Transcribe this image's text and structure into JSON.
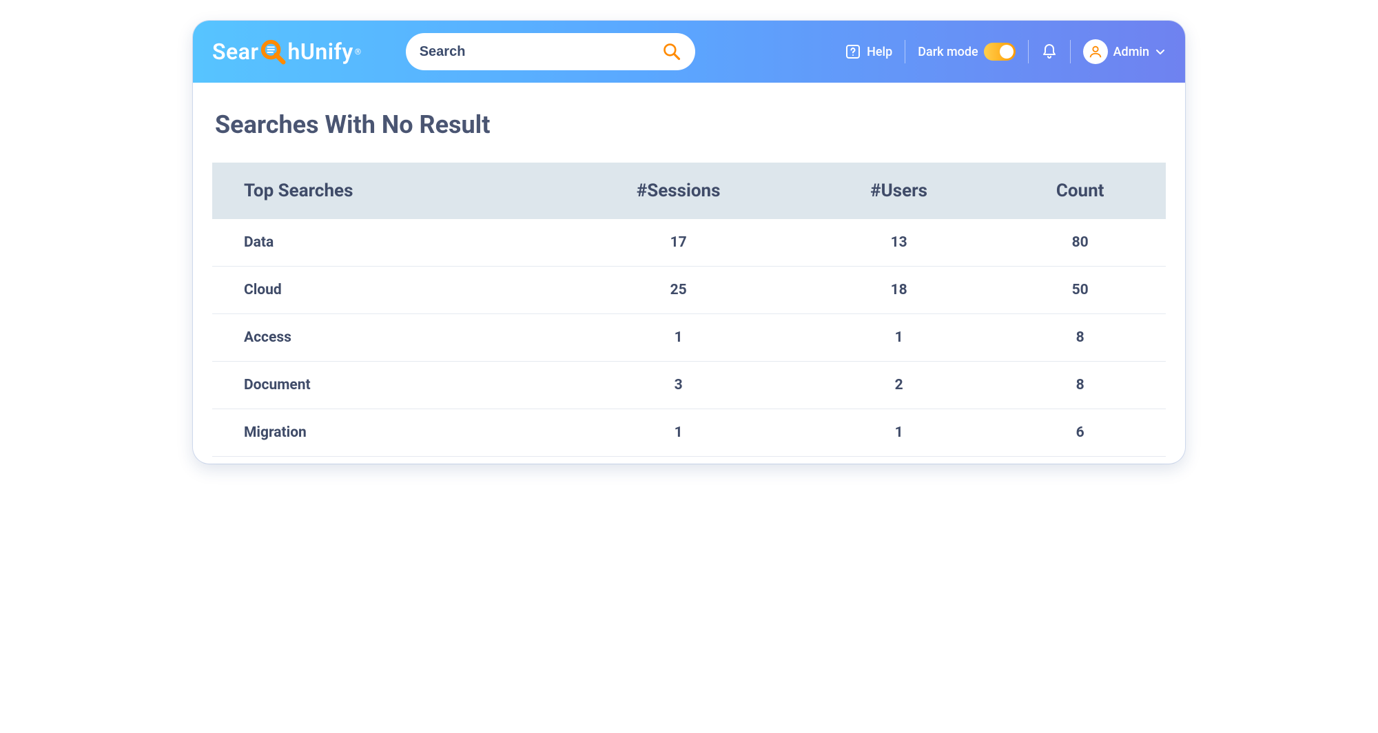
{
  "brand": {
    "part1": "Sear",
    "part2": "hUnify",
    "reg": "®"
  },
  "search": {
    "placeholder": "Search"
  },
  "header": {
    "help_label": "Help",
    "darkmode_label": "Dark mode",
    "user_label": "Admin"
  },
  "page": {
    "title": "Searches With No Result"
  },
  "table": {
    "headers": [
      "Top Searches",
      "#Sessions",
      "#Users",
      "Count"
    ],
    "rows": [
      {
        "term": "Data",
        "sessions": "17",
        "users": "13",
        "count": "80"
      },
      {
        "term": "Cloud",
        "sessions": "25",
        "users": "18",
        "count": "50"
      },
      {
        "term": "Access",
        "sessions": "1",
        "users": "1",
        "count": "8"
      },
      {
        "term": "Document",
        "sessions": "3",
        "users": "2",
        "count": "8"
      },
      {
        "term": "Migration",
        "sessions": "1",
        "users": "1",
        "count": "6"
      }
    ]
  }
}
